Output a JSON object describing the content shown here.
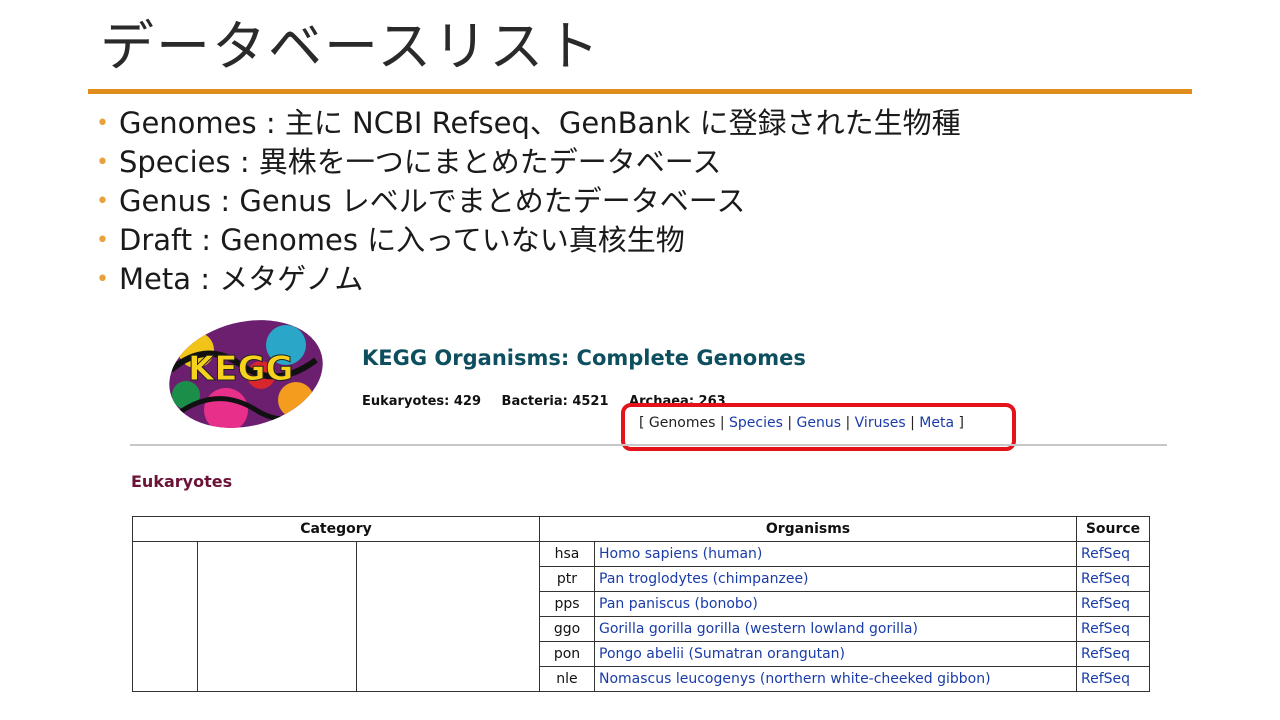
{
  "slide": {
    "title": "データベースリスト",
    "bullets": [
      "Genomes : 主に NCBI Refseq、GenBank に登録された生物種",
      "Species : 異株を一つにまとめたデータベース",
      "Genus : Genus レベルでまとめたデータベース",
      "Draft : Genomes に入っていない真核生物",
      "Meta : メタゲノム"
    ],
    "accent_color": "#e08e1b"
  },
  "kegg": {
    "title": "KEGG Organisms: Complete Genomes",
    "counts": {
      "eukaryotes": "Eukaryotes: 429",
      "bacteria": "Bacteria: 4521",
      "archaea": "Archaea: 263"
    },
    "nav": {
      "open": "[",
      "close": "]",
      "sep": "|",
      "current": "Genomes",
      "links": [
        "Species",
        "Genus",
        "Viruses",
        "Meta"
      ]
    },
    "highlight_color": "#e3121b",
    "section": "Eukaryotes",
    "table": {
      "headers": [
        "Category",
        "Organisms",
        "Source"
      ],
      "rows": [
        {
          "code": "hsa",
          "name": "Homo sapiens (human)",
          "source": "RefSeq"
        },
        {
          "code": "ptr",
          "name": "Pan troglodytes (chimpanzee)",
          "source": "RefSeq"
        },
        {
          "code": "pps",
          "name": "Pan paniscus (bonobo)",
          "source": "RefSeq"
        },
        {
          "code": "ggo",
          "name": "Gorilla gorilla gorilla (western lowland gorilla)",
          "source": "RefSeq"
        },
        {
          "code": "pon",
          "name": "Pongo abelii (Sumatran orangutan)",
          "source": "RefSeq"
        },
        {
          "code": "nle",
          "name": "Nomascus leucogenys (northern white-cheeked gibbon)",
          "source": "RefSeq"
        }
      ]
    }
  }
}
